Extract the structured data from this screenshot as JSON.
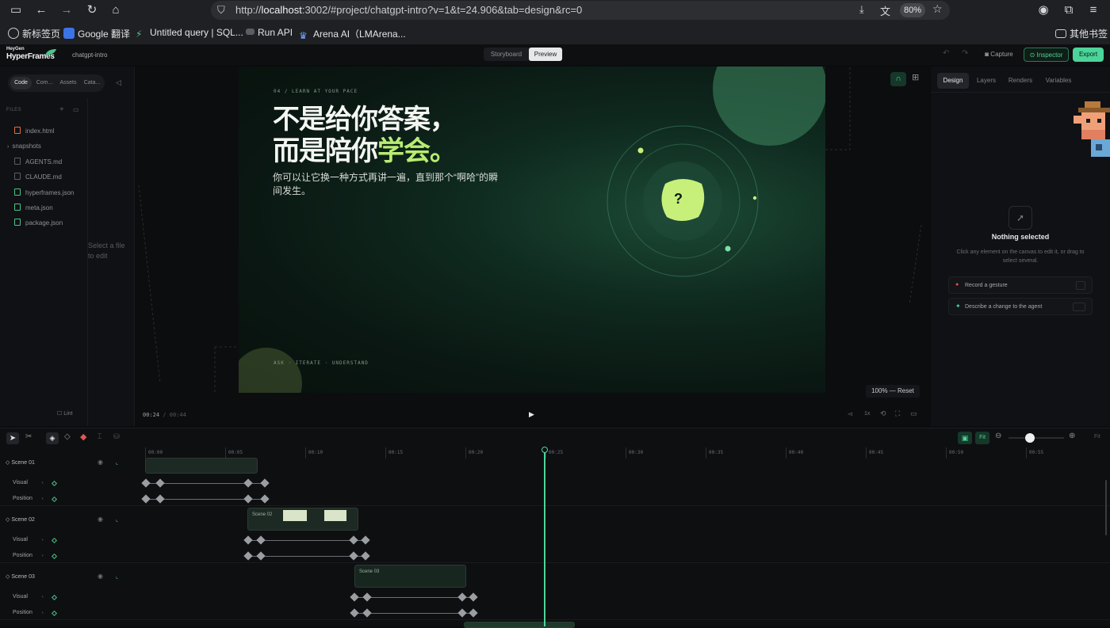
{
  "browser": {
    "url_prefix": "http://",
    "url_host": "localhost",
    "url_rest": ":3002/#project/chatgpt-intro?v=1&t=24.906&tab=design&rc=0",
    "zoom": "80%",
    "bookmarks": [
      "新标签页",
      "Google 翻译",
      "Untitled query | SQL...",
      "Run API",
      "Arena AI（LMArena...",
      "其他书签"
    ]
  },
  "app": {
    "brand_top": "HeyGen",
    "brand_bottom": "HyperFrames",
    "project": "chatgpt-intro",
    "modes": [
      "Storyboard",
      "Preview"
    ],
    "active_mode": "Preview",
    "capture": "Capture",
    "inspector": "Inspector",
    "export": "Export"
  },
  "left": {
    "tabs": [
      "Code",
      "Com...",
      "Assets",
      "Cata..."
    ],
    "files_label": "FILES",
    "files": [
      "index.html",
      "snapshots",
      "AGENTS.md",
      "CLAUDE.md",
      "hyperframes.json",
      "meta.json",
      "package.json"
    ],
    "placeholder": "Select a file to edit",
    "lint": "Lint"
  },
  "stage": {
    "kicker": "04 / LEARN AT YOUR PACE",
    "title_line1": "不是给你答案，",
    "title_line2_a": "而是陪你",
    "title_line2_b": "学会。",
    "subtitle": "你可以让它换一种方式再讲一遍，直到那个“啊哈”的瞬间发生。",
    "footer": "ASK · ITERATE · UNDERSTAND",
    "question": "?",
    "zoom_reset": "100% — Reset",
    "time_current": "00:24",
    "time_total": "00:44",
    "speed": "1x"
  },
  "right": {
    "tabs": [
      "Design",
      "Layers",
      "Renders",
      "Variables"
    ],
    "active_tab": "Design",
    "empty_title": "Nothing selected",
    "empty_desc": "Click any element on the canvas to edit it, or drag to select several.",
    "actions": [
      "Record a gesture",
      "Describe a change to the agent"
    ]
  },
  "timeline": {
    "fit": "Fit",
    "fit2": "Fit",
    "ticks": [
      "00:00",
      "00:05",
      "00:10",
      "00:15",
      "00:20",
      "00:25",
      "00:30",
      "00:35",
      "00:40",
      "00:45",
      "00:50",
      "00:55"
    ],
    "scenes": [
      {
        "name": "Scene 01",
        "tracks": [
          "Visual",
          "Position"
        ],
        "clip_label": ""
      },
      {
        "name": "Scene 02",
        "tracks": [
          "Visual",
          "Position"
        ],
        "clip_label": "Scene 02"
      },
      {
        "name": "Scene 03",
        "tracks": [
          "Visual",
          "Position"
        ],
        "clip_label": "Scene 03"
      }
    ]
  },
  "colors": {
    "accent": "#4cc38a",
    "lime": "#c6f07a",
    "export_bg": "#4cd59a"
  }
}
